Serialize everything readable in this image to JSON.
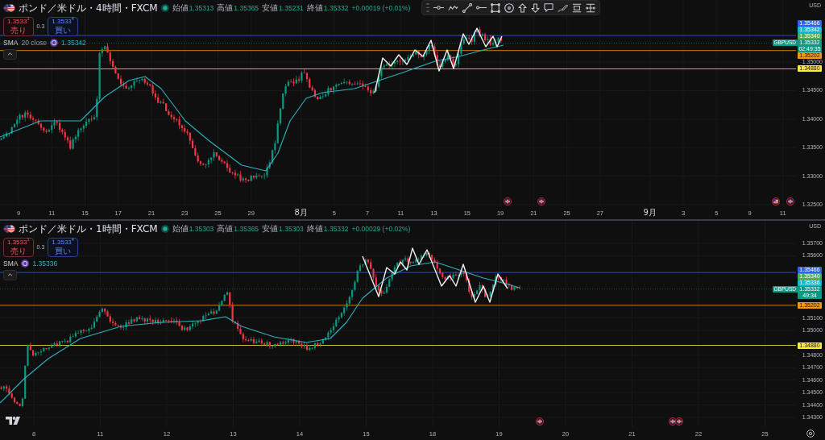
{
  "panels": [
    {
      "symbol": {
        "title": "ポンド／米ドル・4時間・FXCM",
        "ohlc": [
          {
            "label": "始値",
            "value": "1.35313"
          },
          {
            "label": "高値",
            "value": "1.35365"
          },
          {
            "label": "安値",
            "value": "1.35231"
          },
          {
            "label": "終値",
            "value": "1.35332"
          }
        ],
        "change": "+0.00019 (+0.01%)"
      },
      "trade": {
        "sell": {
          "price": "1.3533$^{1}$",
          "label": "売り"
        },
        "spread": "0.3",
        "buy": {
          "price": "1.3533$^{4}$",
          "label": "買い"
        }
      },
      "indicator": {
        "name": "SMA",
        "params": "20 close",
        "value": "1.35342"
      },
      "price_axis": {
        "currency": "USD",
        "labels": [
          {
            "kind": "level",
            "text": "1.35466",
            "color": "#2962ff"
          },
          {
            "kind": "indicator",
            "text": "1.35342",
            "color": "#00bcd4"
          },
          {
            "kind": "indicator",
            "text": "1.35340",
            "color": "#4caf50"
          },
          {
            "kind": "last",
            "symbol": "GBPUSD",
            "text": "1.35332",
            "countdown": "02:49:35",
            "color": "#089981"
          },
          {
            "kind": "level",
            "text": "1.35202",
            "color": "#ff9800"
          },
          {
            "kind": "tick",
            "text": "1.35000"
          },
          {
            "kind": "level",
            "text": "1.34880",
            "color": "#ffeb3b"
          },
          {
            "kind": "tick",
            "text": "1.34500"
          },
          {
            "kind": "tick",
            "text": "1.34000"
          },
          {
            "kind": "tick",
            "text": "1.33500"
          },
          {
            "kind": "tick",
            "text": "1.33000"
          },
          {
            "kind": "tick",
            "text": "1.32500"
          }
        ]
      },
      "time_axis": [
        {
          "kind": "day",
          "text": "9"
        },
        {
          "kind": "day",
          "text": "11"
        },
        {
          "kind": "day",
          "text": "15"
        },
        {
          "kind": "day",
          "text": "17"
        },
        {
          "kind": "day",
          "text": "21"
        },
        {
          "kind": "day",
          "text": "23"
        },
        {
          "kind": "day",
          "text": "25"
        },
        {
          "kind": "day",
          "text": "29"
        },
        {
          "kind": "month",
          "text": "8月"
        },
        {
          "kind": "day",
          "text": "5"
        },
        {
          "kind": "day",
          "text": "7"
        },
        {
          "kind": "day",
          "text": "11"
        },
        {
          "kind": "day",
          "text": "13"
        },
        {
          "kind": "day",
          "text": "15"
        },
        {
          "kind": "day",
          "text": "19"
        },
        {
          "kind": "day",
          "text": "21"
        },
        {
          "kind": "day",
          "text": "25"
        },
        {
          "kind": "day",
          "text": "27"
        },
        {
          "kind": "month",
          "text": "9月"
        },
        {
          "kind": "day",
          "text": "3"
        },
        {
          "kind": "day",
          "text": "5"
        },
        {
          "kind": "day",
          "text": "9"
        },
        {
          "kind": "day",
          "text": "11"
        }
      ]
    },
    {
      "symbol": {
        "title": "ポンド／米ドル・1時間・FXCM",
        "ohlc": [
          {
            "label": "始値",
            "value": "1.35303"
          },
          {
            "label": "高値",
            "value": "1.35365"
          },
          {
            "label": "安値",
            "value": "1.35303"
          },
          {
            "label": "終値",
            "value": "1.35332"
          }
        ],
        "change": "+0.00029 (+0.02%)"
      },
      "trade": {
        "sell": {
          "price": "1.3533$^{1}$",
          "label": "売り"
        },
        "spread": "0.3",
        "buy": {
          "price": "1.3533$^{4}$",
          "label": "買い"
        }
      },
      "indicator": {
        "name": "SMA",
        "value": "1.35336"
      },
      "price_axis": {
        "currency": "USD",
        "labels": [
          {
            "kind": "tick",
            "text": "1.35700"
          },
          {
            "kind": "tick",
            "text": "1.35600"
          },
          {
            "kind": "level",
            "text": "1.35466",
            "color": "#2962ff"
          },
          {
            "kind": "indicator",
            "text": "1.35340",
            "color": "#4caf50"
          },
          {
            "kind": "indicator",
            "text": "1.35336",
            "color": "#00bcd4"
          },
          {
            "kind": "last",
            "symbol": "GBPUSD",
            "text": "1.35332",
            "countdown": "49:34",
            "color": "#089981"
          },
          {
            "kind": "level",
            "text": "1.35202",
            "color": "#ff9800"
          },
          {
            "kind": "tick",
            "text": "1.35100"
          },
          {
            "kind": "tick",
            "text": "1.35000"
          },
          {
            "kind": "level",
            "text": "1.34880",
            "color": "#ffeb3b"
          },
          {
            "kind": "tick",
            "text": "1.34800"
          },
          {
            "kind": "tick",
            "text": "1.34700"
          },
          {
            "kind": "tick",
            "text": "1.34600"
          },
          {
            "kind": "tick",
            "text": "1.34500"
          },
          {
            "kind": "tick",
            "text": "1.34400"
          },
          {
            "kind": "tick",
            "text": "1.34300"
          }
        ]
      },
      "time_axis": [
        {
          "kind": "day",
          "text": "8"
        },
        {
          "kind": "day",
          "text": "11"
        },
        {
          "kind": "day",
          "text": "12"
        },
        {
          "kind": "day",
          "text": "13"
        },
        {
          "kind": "day",
          "text": "14"
        },
        {
          "kind": "day",
          "text": "15"
        },
        {
          "kind": "day",
          "text": "18"
        },
        {
          "kind": "day",
          "text": "19"
        },
        {
          "kind": "day",
          "text": "20"
        },
        {
          "kind": "day",
          "text": "21"
        },
        {
          "kind": "day",
          "text": "22"
        },
        {
          "kind": "day",
          "text": "25"
        }
      ]
    }
  ]
}
